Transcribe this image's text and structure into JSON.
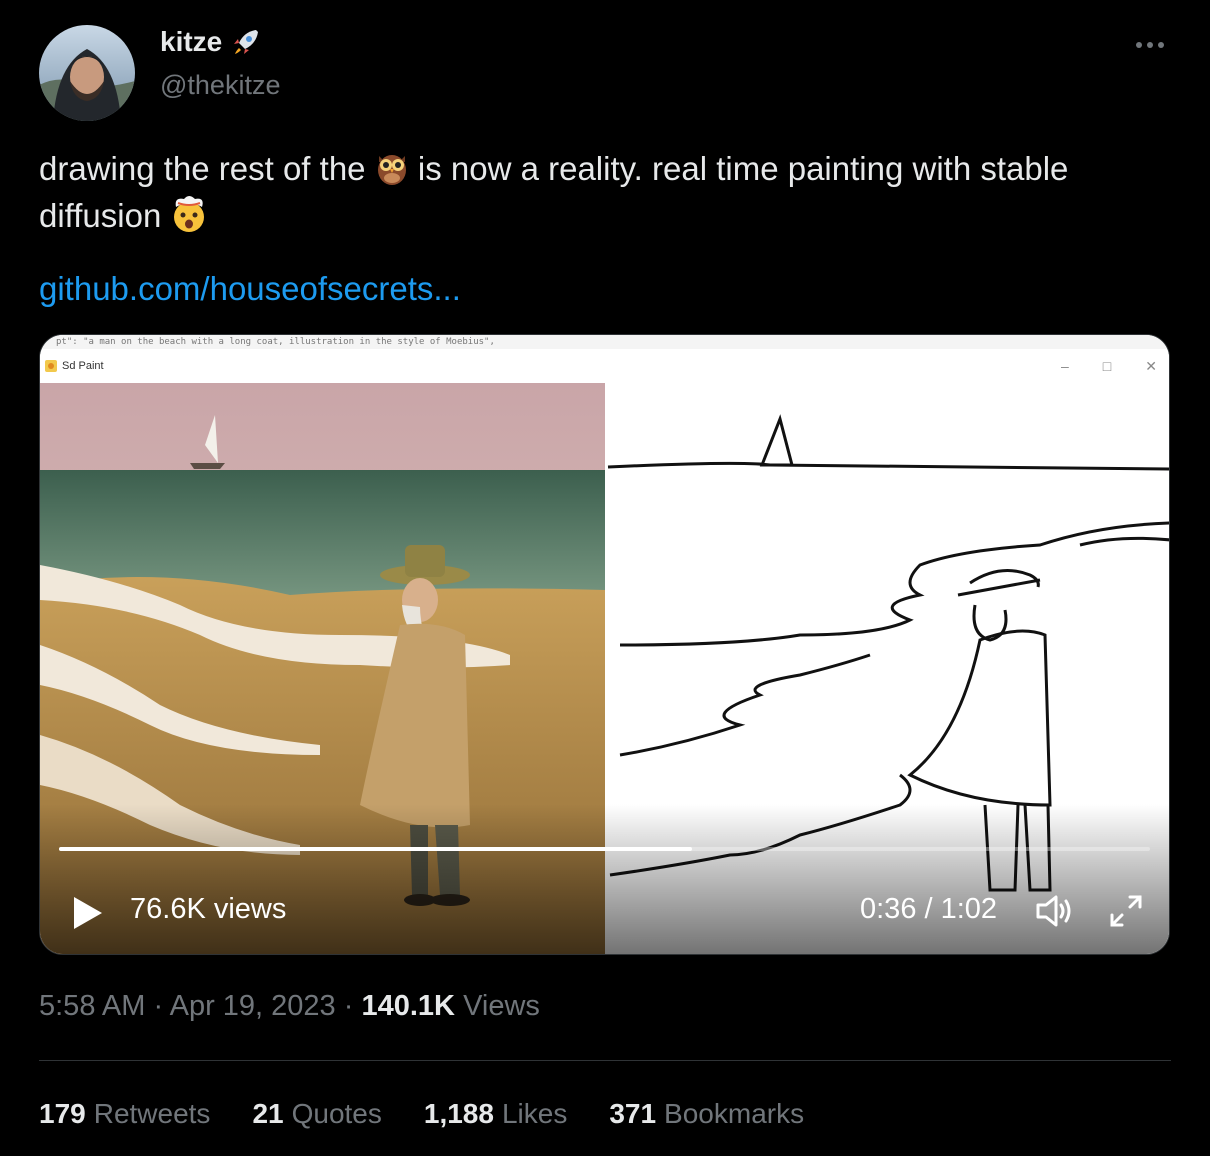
{
  "author": {
    "display_name": "kitze",
    "handle": "@thekitze",
    "badge_icon": "rocket-emoji"
  },
  "tweet": {
    "text_part1": "drawing the rest of the ",
    "emoji_1": "owl-emoji",
    "text_part2": " is now a reality. real time painting with stable diffusion ",
    "emoji_2": "exploding-head-emoji",
    "link": "github.com/houseofsecrets..."
  },
  "media": {
    "prompt_text": "pt\": \"a man on the beach with a long coat, illustration in the style of Moebius\",",
    "app_title": "Sd Paint",
    "window_controls": [
      "–",
      "□",
      "✕"
    ],
    "views_label": "76.6K views",
    "time_label": "0:36 / 1:02",
    "progress": 0.58
  },
  "meta": {
    "time": "5:58 AM",
    "separator": "·",
    "date": "Apr 19, 2023",
    "views_count": "140.1K",
    "views_label": "Views"
  },
  "stats": [
    {
      "count": "179",
      "label": "Retweets"
    },
    {
      "count": "21",
      "label": "Quotes"
    },
    {
      "count": "1,188",
      "label": "Likes"
    },
    {
      "count": "371",
      "label": "Bookmarks"
    }
  ],
  "colors": {
    "background": "#000000",
    "text": "#e7e9ea",
    "muted": "#71767b",
    "link": "#1d9bf0",
    "divider": "#2f3336"
  }
}
